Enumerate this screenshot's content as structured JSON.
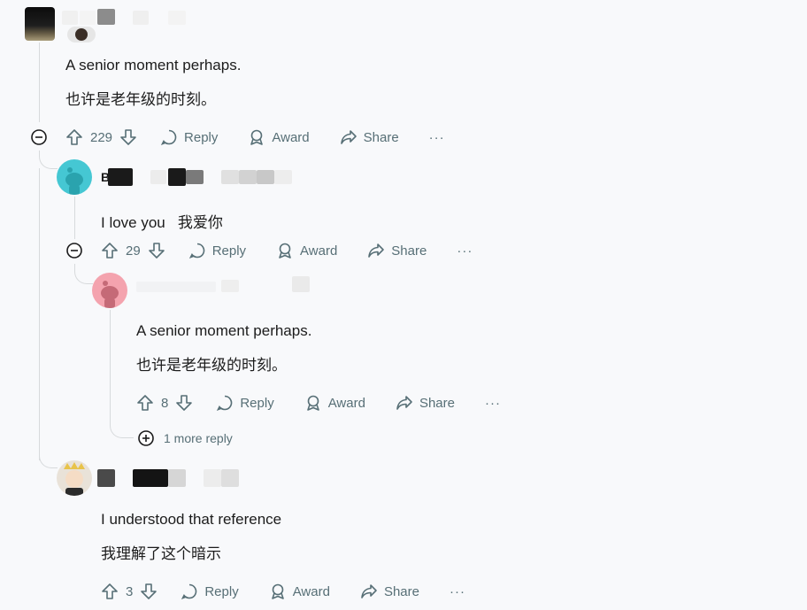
{
  "colors": {
    "background": "#f8f9fb",
    "meta_text": "#576f76",
    "thread_line": "#d7dadc",
    "avatar_teal": "#45c7d3",
    "avatar_pink": "#f4a3ae"
  },
  "comments": [
    {
      "id": "c1",
      "username": "",
      "body_en": "A senior moment perhaps.",
      "body_zh": "也许是老年级的时刻。",
      "votes": "229",
      "actions": {
        "reply": "Reply",
        "award": "Award",
        "share": "Share",
        "more": "···"
      }
    },
    {
      "id": "c2",
      "username": "B",
      "body_en": "I love you   我爱你",
      "votes": "29",
      "actions": {
        "reply": "Reply",
        "award": "Award",
        "share": "Share",
        "more": "···"
      }
    },
    {
      "id": "c3",
      "username": "",
      "body_en": "A senior moment perhaps.",
      "body_zh": "也许是老年级的时刻。",
      "votes": "8",
      "actions": {
        "reply": "Reply",
        "award": "Award",
        "share": "Share",
        "more": "···"
      },
      "more_replies": "1 more reply"
    },
    {
      "id": "c4",
      "username": "",
      "body_en": "I understood that reference",
      "body_zh": "我理解了这个暗示",
      "votes": "3",
      "actions": {
        "reply": "Reply",
        "award": "Award",
        "share": "Share",
        "more": "···"
      }
    }
  ]
}
